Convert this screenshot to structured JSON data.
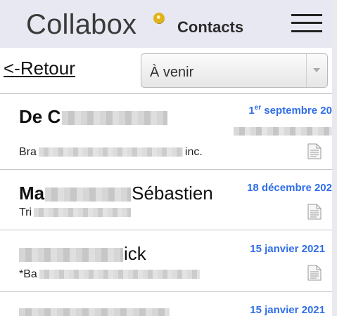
{
  "header": {
    "logo_text": "Collabox",
    "title": "Contacts",
    "menu_icon": "hamburger-menu-icon"
  },
  "toolbar": {
    "back_label": "<-Retour",
    "filter_value": "À venir"
  },
  "contacts": [
    {
      "name_visible": "De C",
      "name_bold": true,
      "company_start": "Bra",
      "company_end": "inc.",
      "date_day": "1",
      "date_sup": "er",
      "date_rest": " septembre 20",
      "icon": "document-icon"
    },
    {
      "name_visible": "Ma",
      "name_tail": "Sébastien",
      "name_bold": true,
      "company_start": "Tri",
      "company_end": "",
      "date_day": "",
      "date_sup": "",
      "date_rest": "18 décembre 202",
      "icon": "document-icon"
    },
    {
      "name_visible": "",
      "name_tail": "ick",
      "name_bold": false,
      "company_start": "*Ba",
      "company_end": "",
      "date_day": "",
      "date_sup": "",
      "date_rest": "15 janvier 2021",
      "icon": "document-icon"
    },
    {
      "name_visible": "",
      "name_tail": "",
      "name_bold": false,
      "company_start": "",
      "company_end": "",
      "date_day": "",
      "date_sup": "",
      "date_rest": "15 janvier 2021",
      "icon": "document-icon"
    }
  ],
  "colors": {
    "header_bg": "#e8e8f2",
    "date_blue": "#2f6ee8",
    "logo_dot": "#e2b21a"
  }
}
